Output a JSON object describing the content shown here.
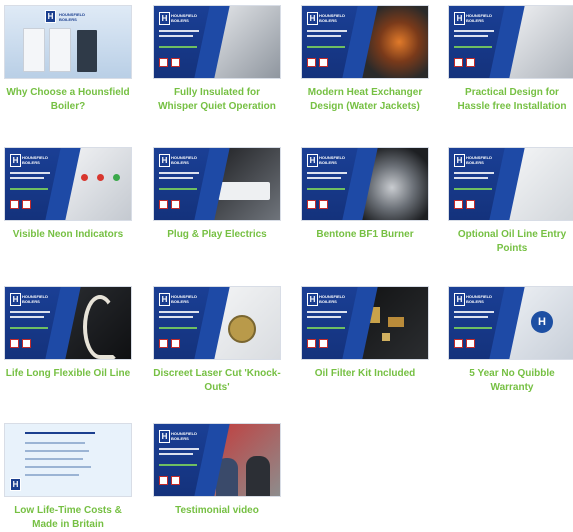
{
  "gallery": {
    "videos": [
      {
        "caption": "Why Choose a Hounsfield Boiler?"
      },
      {
        "caption": "Fully Insulated for Whisper Quiet Operation"
      },
      {
        "caption": "Modern Heat Exchanger Design (Water Jackets)"
      },
      {
        "caption": "Practical Design for Hassle free Installation"
      },
      {
        "caption": "Visible Neon Indicators"
      },
      {
        "caption": "Plug & Play Electrics"
      },
      {
        "caption": "Bentone BF1 Burner"
      },
      {
        "caption": "Optional Oil Line Entry Points"
      },
      {
        "caption": "Life Long Flexible Oil Line"
      },
      {
        "caption": "Discreet Laser Cut 'Knock-Outs'"
      },
      {
        "caption": "Oil Filter Kit Included"
      },
      {
        "caption": "5 Year No Quibble Warranty"
      },
      {
        "caption": "Low Life-Time Costs & Made in Britain"
      },
      {
        "caption": "Testimonial video"
      }
    ]
  },
  "thumbnail": {
    "logo_letter": "H",
    "brand_text": "HOUNSFIELD BOILERS"
  },
  "colors": {
    "caption_green": "#76c043",
    "brand_blue": "#1b3f8f"
  }
}
